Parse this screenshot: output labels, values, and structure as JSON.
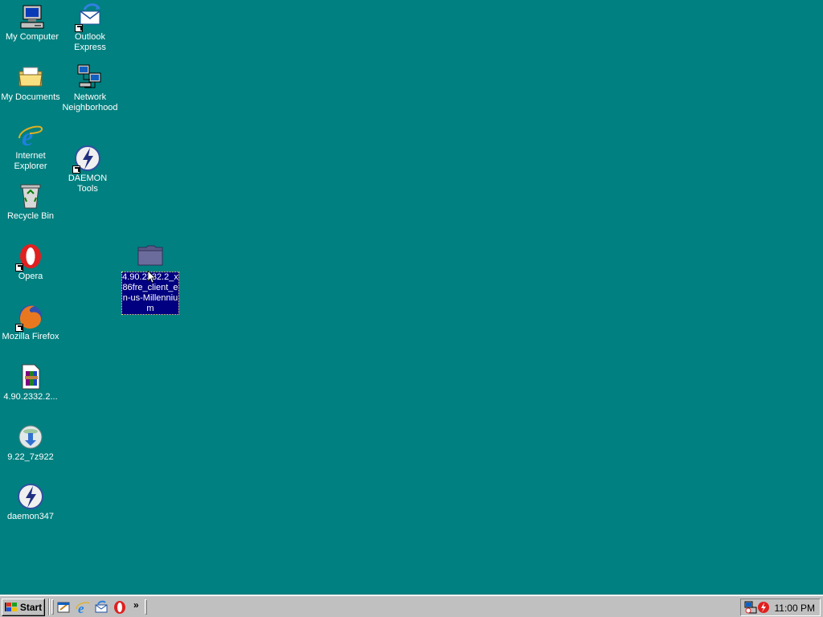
{
  "desktop": {
    "background": "#008080",
    "icons": [
      {
        "name": "my-computer",
        "label": "My Computer",
        "icon": "computer-icon"
      },
      {
        "name": "outlook-express",
        "label": "Outlook Express",
        "icon": "outlook-express-icon",
        "shortcut": true
      },
      {
        "name": "my-documents",
        "label": "My Documents",
        "icon": "folder-documents-icon"
      },
      {
        "name": "network-neighborhood",
        "label": "Network Neighborhood",
        "icon": "network-icon"
      },
      {
        "name": "internet-explorer",
        "label": "Internet Explorer",
        "icon": "internet-explorer-icon"
      },
      {
        "name": "daemon-tools",
        "label": "DAEMON Tools",
        "icon": "daemon-tools-icon",
        "shortcut": true
      },
      {
        "name": "recycle-bin",
        "label": "Recycle Bin",
        "icon": "recycle-bin-icon"
      },
      {
        "name": "opera",
        "label": "Opera",
        "icon": "opera-icon",
        "shortcut": true
      },
      {
        "name": "mozilla-firefox",
        "label": "Mozilla Firefox",
        "icon": "firefox-icon",
        "shortcut": true
      },
      {
        "name": "file-4-90",
        "label": "4.90.2332.2...",
        "icon": "winrar-archive-icon"
      },
      {
        "name": "file-7z",
        "label": "9.22_7z922",
        "icon": "installer-icon"
      },
      {
        "name": "daemon347",
        "label": "daemon347",
        "icon": "daemon-tools-icon"
      },
      {
        "name": "selected-folder",
        "label": "4.90.2332.2_x86fre_client_en-us-Millennium",
        "icon": "folder-icon",
        "selected": true
      }
    ]
  },
  "taskbar": {
    "start_label": "Start",
    "quick_launch": [
      "show-desktop-icon",
      "internet-explorer-icon",
      "outlook-express-icon",
      "opera-icon"
    ],
    "more_label": "»",
    "tray_icons": [
      "network-status-icon",
      "daemon-tools-tray-icon"
    ],
    "clock": "11:00 PM"
  }
}
